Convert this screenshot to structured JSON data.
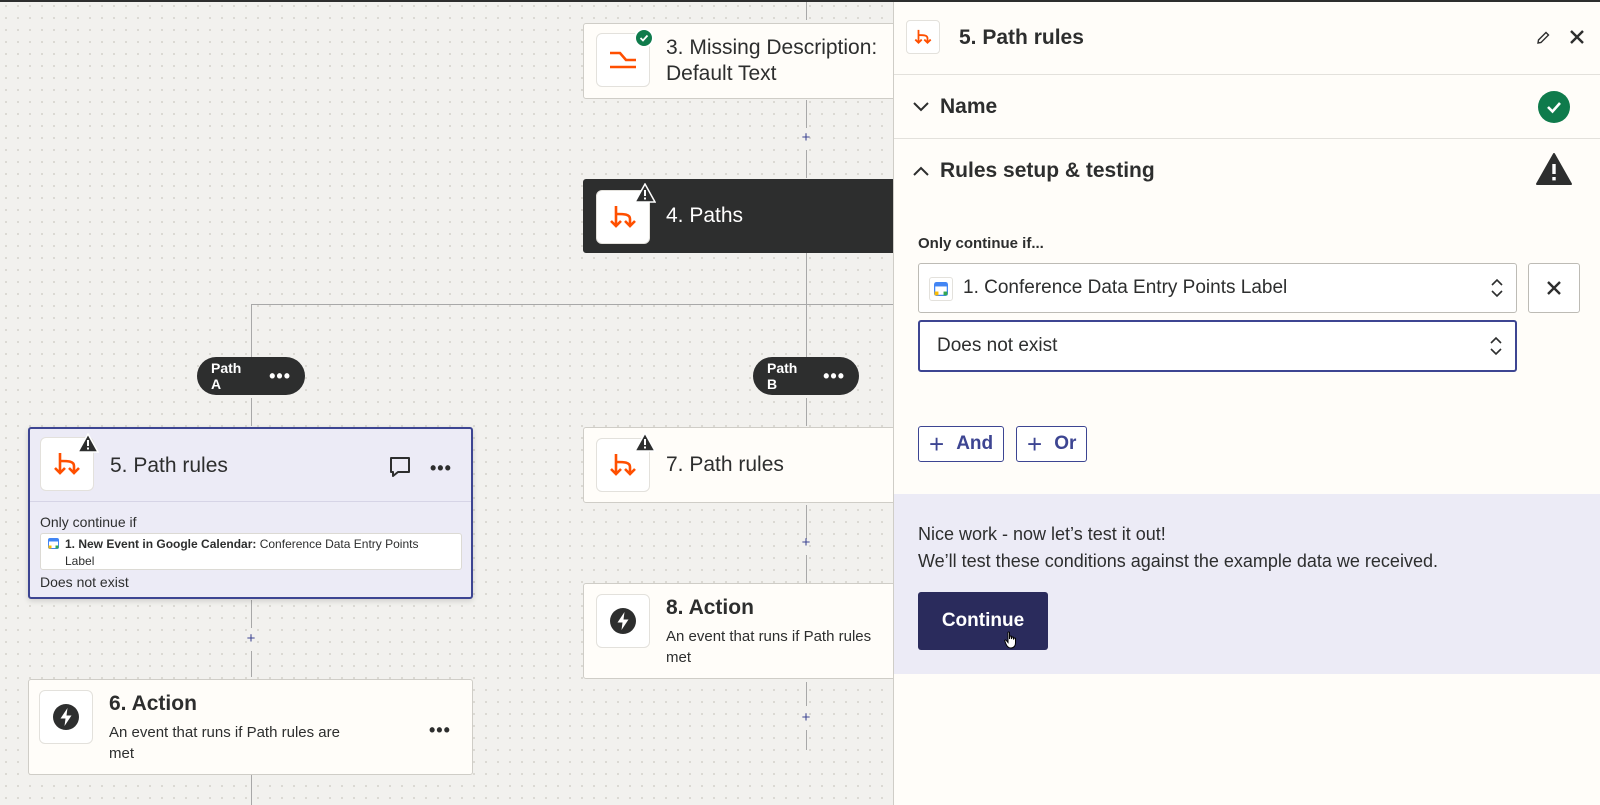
{
  "canvas": {
    "step3": {
      "title_line1": "3. Missing Description:",
      "title_line2": "Default Text"
    },
    "step4": {
      "title": "4. Paths"
    },
    "pathA": {
      "label": "Path A",
      "more": "•••"
    },
    "pathB": {
      "label": "Path B",
      "more": "•••"
    },
    "step5": {
      "title": "5. Path rules",
      "rule_intro": "Only continue if",
      "rule_app": "1. New Event in Google Calendar:",
      "rule_field_line1": "Conference Data Entry Points",
      "rule_field_line2": "Label",
      "rule_condition": "Does not exist",
      "more": "•••"
    },
    "step6": {
      "title": "6. Action",
      "sub_line1": "An event that runs if Path rules are",
      "sub_line2": "met",
      "more": "•••"
    },
    "step7": {
      "title": "7. Path rules"
    },
    "step8": {
      "title": "8. Action",
      "sub_line1": "An event that runs if Path rules",
      "sub_line2": "met"
    },
    "plus": "+"
  },
  "panel": {
    "title": "5. Path rules",
    "sections": {
      "name": {
        "label": "Name",
        "status": "complete"
      },
      "rules": {
        "label": "Rules setup & testing",
        "status": "warning"
      }
    },
    "only_continue_label": "Only continue if...",
    "field_value": "1. Conference Data Entry Points Label",
    "condition_value": "Does not exist",
    "and_label": "And",
    "or_label": "Or",
    "test": {
      "heading": "Nice work - now let’s test it out!",
      "body": "We’ll test these conditions against the example data we received.",
      "continue_label": "Continue"
    }
  },
  "colors": {
    "brand_orange": "#ff4f00",
    "accent_navy": "#3d4592",
    "button_dark": "#2a2b5c",
    "success_green": "#0f7b4c",
    "dark_card": "#2d2e2e"
  }
}
